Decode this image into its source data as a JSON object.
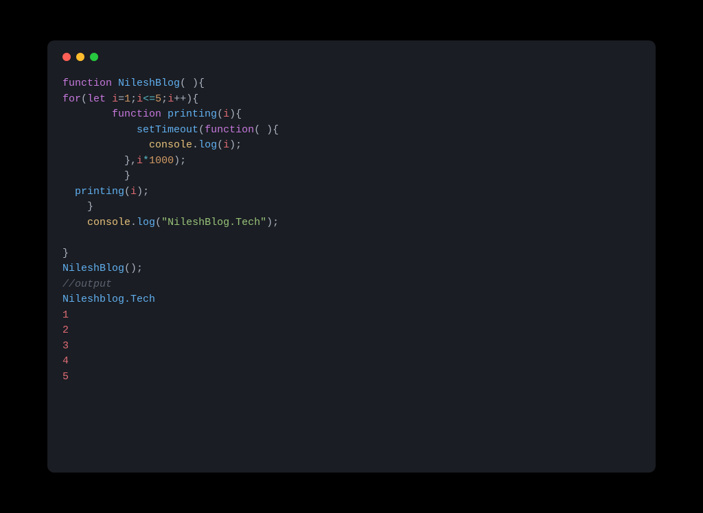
{
  "code": {
    "l1_kw1": "function",
    "l1_fn": "NileshBlog",
    "l1_rest": "( ){",
    "l2_kw1": "for",
    "l2_p1": "(",
    "l2_kw2": "let",
    "l2_sp1": " ",
    "l2_var1": "i",
    "l2_eq": "=",
    "l2_n1": "1",
    "l2_sc1": ";",
    "l2_var2": "i",
    "l2_op1": "<=",
    "l2_n2": "5",
    "l2_sc2": ";",
    "l2_var3": "i",
    "l2_op2": "++",
    "l2_p2": "){",
    "l3_pad": "        ",
    "l3_kw": "function",
    "l3_sp": " ",
    "l3_fn": "printing",
    "l3_p1": "(",
    "l3_var": "i",
    "l3_p2": "){",
    "l4_pad": "            ",
    "l4_fn": "setTimeout",
    "l4_p1": "(",
    "l4_kw": "function",
    "l4_p2": "( ){",
    "l5_pad": "              ",
    "l5_obj": "console",
    "l5_dot": ".",
    "l5_fn": "log",
    "l5_p1": "(",
    "l5_var": "i",
    "l5_p2": ");",
    "l6_pad": "          ",
    "l6_p1": "},",
    "l6_var": "i",
    "l6_op": "*",
    "l6_num": "1000",
    "l6_p2": ");",
    "l7_pad": "          ",
    "l7_p": "}",
    "l8_pad": "  ",
    "l8_fn": "printing",
    "l8_p1": "(",
    "l8_var": "i",
    "l8_p2": ");",
    "l9_pad": "    ",
    "l9_p": "}",
    "l10_pad": "    ",
    "l10_obj": "console",
    "l10_dot": ".",
    "l10_fn": "log",
    "l10_p1": "(",
    "l10_str": "\"NileshBlog.Tech\"",
    "l10_p2": ");",
    "l11": "",
    "l12": "}",
    "l13_fn": "NileshBlog",
    "l13_p": "();",
    "l14": "//output",
    "l15": "Nileshblog.Tech",
    "l16": "1",
    "l17": "2",
    "l18": "3",
    "l19": "4",
    "l20": "5"
  },
  "window": {
    "close": "close",
    "minimize": "minimize",
    "maximize": "maximize"
  }
}
